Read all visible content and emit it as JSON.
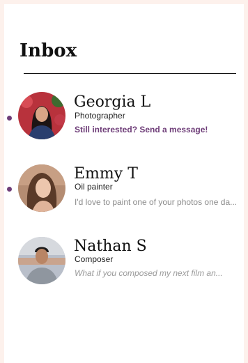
{
  "header": {
    "title": "Inbox"
  },
  "conversations": [
    {
      "name": "Georgia L",
      "role": "Photographer",
      "preview": "Still interested? Send a message!",
      "unread": true
    },
    {
      "name": "Emmy T",
      "role": "Oil painter",
      "preview": "I'd love to paint one of your photos one da...",
      "unread": true
    },
    {
      "name": "Nathan S",
      "role": "Composer",
      "preview": "What if you composed my next film an...",
      "unread": false
    }
  ],
  "colors": {
    "accent": "#6e3d78",
    "frame": "#fdf1ec"
  }
}
